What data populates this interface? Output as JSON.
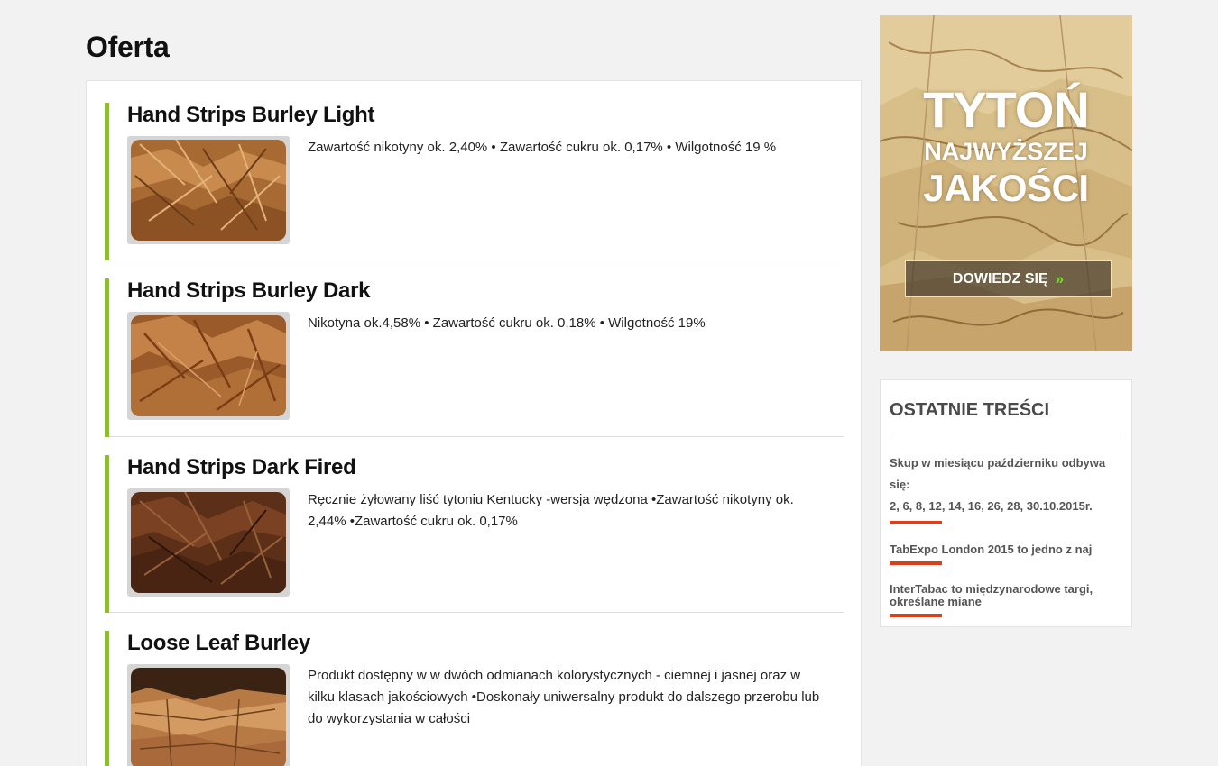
{
  "page": {
    "title": "Oferta"
  },
  "products": [
    {
      "name": "Hand Strips Burley Light",
      "description": "Zawartość nikotyny ok. 2,40% • Zawartość cukru ok. 0,17% • Wilgotność 19 %"
    },
    {
      "name": "Hand Strips Burley Dark",
      "description": "Nikotyna ok.4,58% • Zawartość cukru ok. 0,18% • Wilgotność 19%"
    },
    {
      "name": "Hand Strips Dark Fired",
      "description": "Ręcznie żyłowany liść tytoniu Kentucky -wersja wędzona •Zawartość nikotyny ok. 2,44% •Zawartość cukru ok. 0,17%"
    },
    {
      "name": "Loose Leaf Burley",
      "description": "Produkt dostępny w w dwóch odmianach kolorystycznych - ciemnej i jasnej oraz w kilku klasach jakościowych •Doskonały uniwersalny produkt do dalszego przerobu lub do wykorzystania w całości"
    }
  ],
  "banner": {
    "line1": "TYTOŃ",
    "line2": "NAJWYŻSZEJ",
    "line3": "JAKOŚCI",
    "cta_label": "DOWIEDZ SIĘ",
    "cta_icon": "»"
  },
  "recent": {
    "heading": "OSTATNIE TREŚCI",
    "items": [
      {
        "line1": "Skup w miesiącu październiku odbywa się:",
        "line2": "2, 6, 8, 12, 14, 16, 26, 28, 30.10.2015r."
      },
      {
        "line1": "TabExpo London 2015 to jedno z naj"
      },
      {
        "line1": "InterTabac to międzynarodowe targi, określane miane"
      }
    ]
  },
  "colors": {
    "accent_bar": "#8fba3a",
    "underline": "#d9401c",
    "cta_arrow": "#6ee02a",
    "background": "#f2f2f2"
  }
}
